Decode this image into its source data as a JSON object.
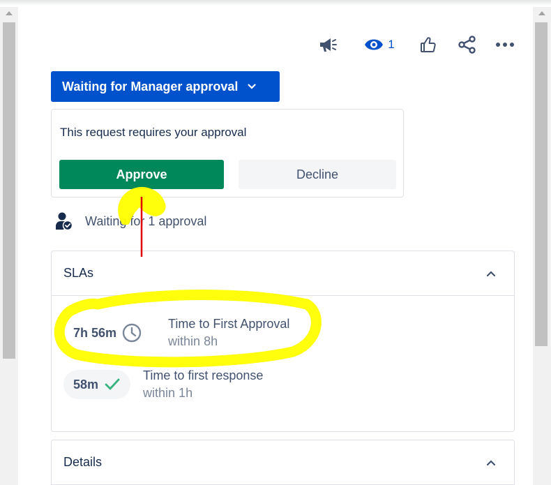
{
  "toolbar": {
    "watch_count": "1",
    "icons": [
      "megaphone-icon",
      "eye-icon",
      "thumbs-up-icon",
      "share-icon",
      "more-icon"
    ]
  },
  "status": {
    "label": "Waiting for Manager approval",
    "color": "#0052cc"
  },
  "approval": {
    "prompt": "This request requires your approval",
    "approve_label": "Approve",
    "decline_label": "Decline",
    "approve_color": "#00875a",
    "waiting_text": "Waiting for 1 approval"
  },
  "sla": {
    "title": "SLAs",
    "items": [
      {
        "time": "7h 56m",
        "name": "Time to First Approval",
        "goal": "within 8h",
        "icon": "clock-icon"
      },
      {
        "time": "58m",
        "name": "Time to first response",
        "goal": "within 1h",
        "icon": "check-icon"
      }
    ]
  },
  "details": {
    "title": "Details"
  },
  "annotation_colors": {
    "highlight": "#ffff00",
    "arrow": "#e00000"
  }
}
